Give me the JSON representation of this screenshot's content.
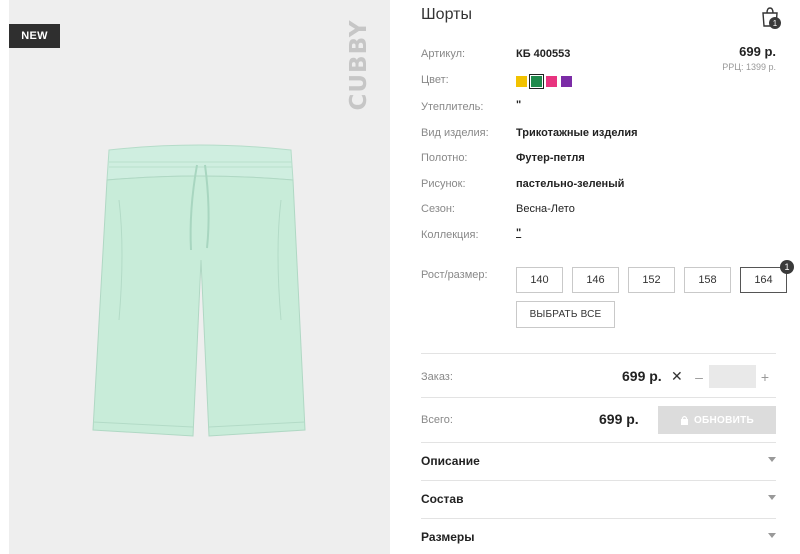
{
  "badge": "NEW",
  "brand": "CUBBY",
  "product": {
    "title": "Шорты",
    "product_color": "#c8ecd9"
  },
  "cart": {
    "icon": "shopping-bag-icon",
    "count": "1"
  },
  "attributes": [
    {
      "label": "Артикул:",
      "value": "КБ 400553"
    },
    {
      "label": "Цвет:",
      "value": ""
    },
    {
      "label": "Утеплитель:",
      "value": "\""
    },
    {
      "label": "Вид изделия:",
      "value": "Трикотажные изделия"
    },
    {
      "label": "Полотно:",
      "value": "Футер-петля"
    },
    {
      "label": "Рисунок:",
      "value": "пастельно-зеленый"
    },
    {
      "label": "Сезон:",
      "value": "Весна-Лето"
    },
    {
      "label": "Коллекция:",
      "value": "\""
    }
  ],
  "price": {
    "main": "699 р.",
    "rrp": "РРЦ: 1399 р."
  },
  "swatches": [
    {
      "color": "#f2c200",
      "selected": false
    },
    {
      "color": "#1f8a4c",
      "selected": true
    },
    {
      "color": "#e8347f",
      "selected": false
    },
    {
      "color": "#7b2ca6",
      "selected": false
    }
  ],
  "sizes": {
    "label": "Рост/размер:",
    "options": [
      "140",
      "146",
      "152",
      "158",
      "164"
    ],
    "selected_index": 4,
    "selected_count": "1",
    "select_all_label": "ВЫБРАТЬ ВСЕ"
  },
  "order": {
    "label": "Заказ:",
    "price": "699 р.",
    "times": "✕",
    "minus": "–",
    "plus": "+",
    "quantity": ""
  },
  "total": {
    "label": "Всего:",
    "price": "699 р.",
    "update_label": "ОБНОВИТЬ"
  },
  "accordions": [
    "Описание",
    "Состав",
    "Размеры"
  ]
}
